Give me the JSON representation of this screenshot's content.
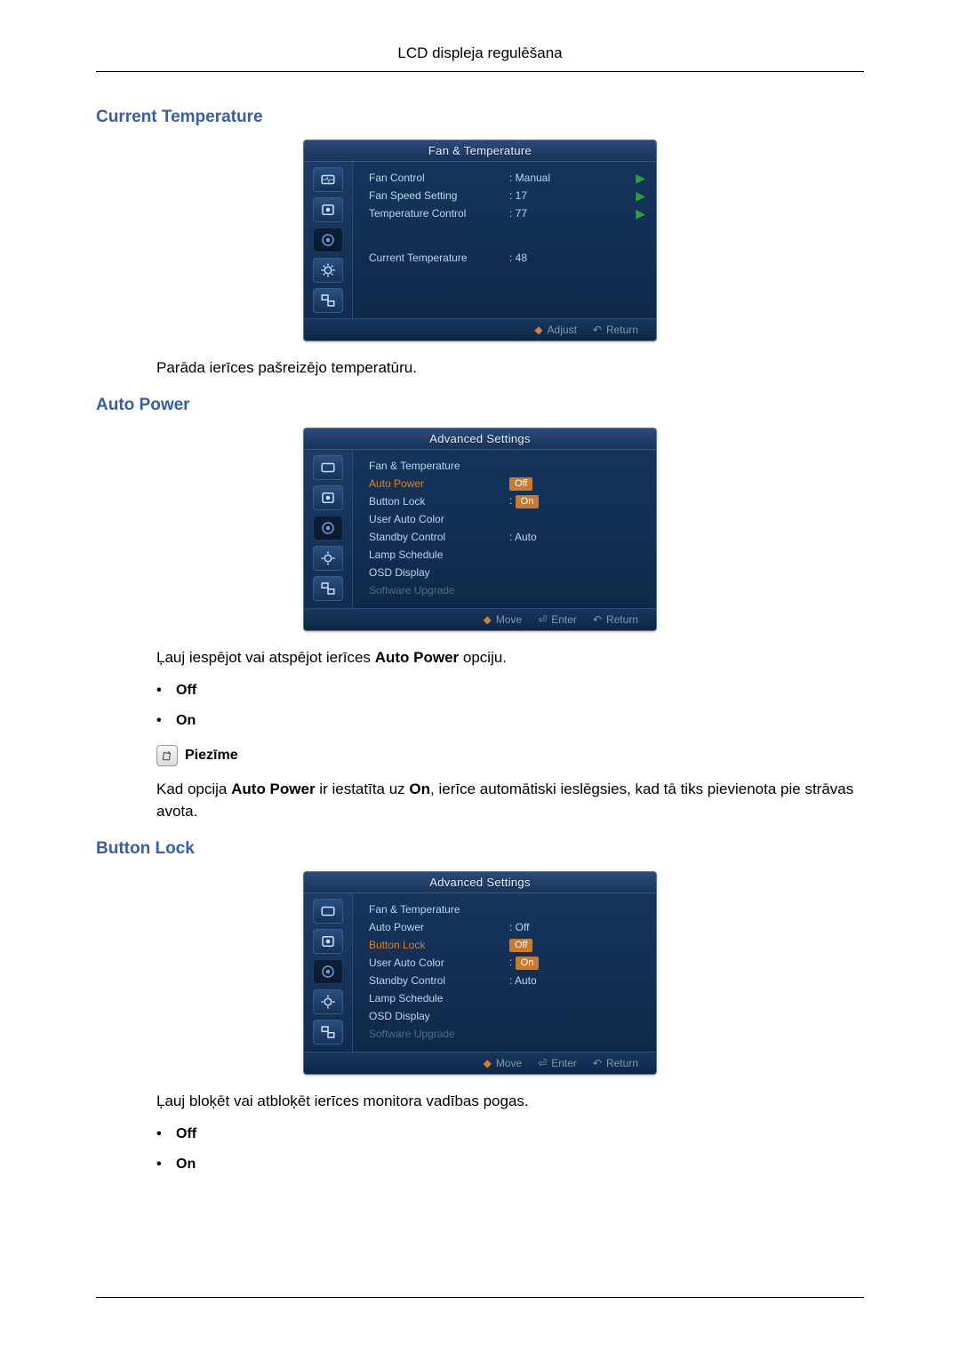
{
  "header": {
    "title": "LCD displeja regulēšana"
  },
  "sections": {
    "current_temperature": {
      "title": "Current Temperature",
      "desc": "Parāda ierīces pašreizējo temperatūru."
    },
    "auto_power": {
      "title": "Auto Power",
      "desc_prefix": "Ļauj iespējot vai atspējot ierīces ",
      "desc_bold": "Auto Power",
      "desc_suffix": " opciju.",
      "bullets": {
        "off": "Off",
        "on": "On"
      },
      "note_label": "Piezīme",
      "note_p1a": "Kad opcija ",
      "note_p1b": "Auto Power",
      "note_p1c": " ir iestatīta uz ",
      "note_p1d": "On",
      "note_p1e": ", ierīce automātiski ieslēgsies, kad tā tiks pievienota pie strāvas avota."
    },
    "button_lock": {
      "title": "Button Lock",
      "desc": "Ļauj bloķēt vai atbloķēt ierīces monitora vadības pogas.",
      "bullets": {
        "off": "Off",
        "on": "On"
      }
    }
  },
  "osd_fan": {
    "title": "Fan & Temperature",
    "rows": {
      "fan_control": {
        "label": "Fan Control",
        "value": ": Manual"
      },
      "fan_speed": {
        "label": "Fan Speed Setting",
        "value": ": 17"
      },
      "temp_control": {
        "label": "Temperature Control",
        "value": ": 77"
      },
      "current_temp": {
        "label": "Current Temperature",
        "value": ": 48"
      }
    },
    "footer": {
      "adjust": "Adjust",
      "ret": "Return"
    }
  },
  "osd_adv_autopower": {
    "title": "Advanced Settings",
    "rows": {
      "fan_temp": {
        "label": "Fan & Temperature"
      },
      "auto_power": {
        "label": "Auto Power",
        "pill_off": "Off"
      },
      "button_lock": {
        "label": "Button Lock",
        "pill_on": "On",
        "colon": ": "
      },
      "user_color": {
        "label": "User Auto Color"
      },
      "standby": {
        "label": "Standby Control",
        "value": ": Auto"
      },
      "lamp": {
        "label": "Lamp Schedule"
      },
      "osd": {
        "label": "OSD Display"
      },
      "software": {
        "label": "Software Upgrade"
      }
    },
    "footer": {
      "move": "Move",
      "enter": "Enter",
      "ret": "Return"
    }
  },
  "osd_adv_buttonlock": {
    "title": "Advanced Settings",
    "rows": {
      "fan_temp": {
        "label": "Fan & Temperature"
      },
      "auto_power": {
        "label": "Auto Power",
        "value": ": Off"
      },
      "button_lock": {
        "label": "Button Lock",
        "pill_off": "Off"
      },
      "user_color": {
        "label": "User Auto Color",
        "pill_on": "On",
        "colon": ": "
      },
      "standby": {
        "label": "Standby Control",
        "value": ": Auto"
      },
      "lamp": {
        "label": "Lamp Schedule"
      },
      "osd": {
        "label": "OSD Display"
      },
      "software": {
        "label": "Software Upgrade"
      }
    },
    "footer": {
      "move": "Move",
      "enter": "Enter",
      "ret": "Return"
    }
  }
}
